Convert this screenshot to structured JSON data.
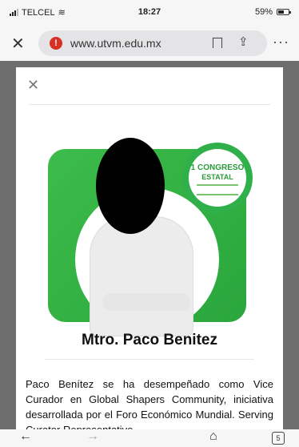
{
  "status_bar": {
    "carrier": "TELCEL",
    "time": "18:27",
    "battery": "59%"
  },
  "browser": {
    "url": "www.utvm.edu.mx",
    "tab_count": "5"
  },
  "modal": {
    "badge": {
      "line1": "1 CONGRESO",
      "line2": "ESTATAL"
    },
    "name": "Mtro. Paco Benitez",
    "bio": "Paco Benítez se ha desempeñado como Vice Curador en Global Shapers Community, iniciativa desarrollada por el Foro Económico Mundial. Serving Curator Representative..."
  }
}
